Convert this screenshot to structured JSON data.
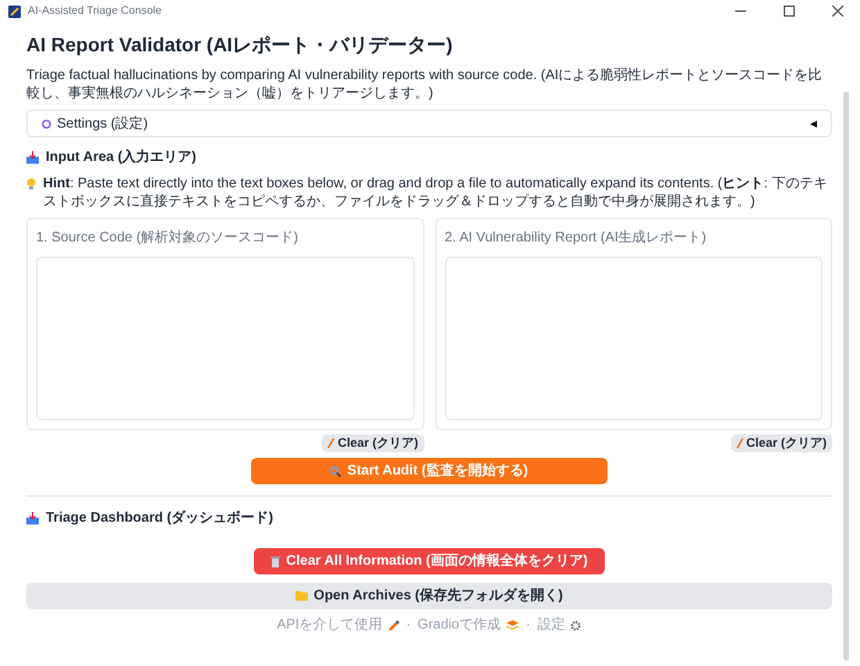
{
  "window": {
    "title": "AI-Assisted Triage Console"
  },
  "heading": "AI Report Validator (AIレポート・バリデーター)",
  "description": "Triage factual hallucinations by comparing AI vulnerability reports with source code. (AIによる脆弱性レポートとソースコードを比較し、事実無根のハルシネーション（嘘）をトリアージします。)",
  "settings": {
    "label": "Settings (設定)",
    "expanded": false
  },
  "input_area": {
    "title": "Input Area (入力エリア)",
    "hint": "**Hint**: Paste text directly into the text boxes below, or drag and drop a file to automatically expand its contents. (**ヒント**: 下のテキストボックスに直接テキストをコピペするか、ファイルをドラッグ＆ドロップすると自動で中身が展開されます。)",
    "fields": [
      {
        "label": "1. Source Code (解析対象のソースコード)",
        "clear": "Clear (クリア)"
      },
      {
        "label": "2. AI Vulnerability Report (AI生成レポート)",
        "clear": "Clear (クリア)"
      }
    ]
  },
  "start_button": "Start Audit (監査を開始する)",
  "dashboard": {
    "title": "Triage Dashboard (ダッシュボード)"
  },
  "clear_all_button": "Clear All Information (画面の情報全体をクリア)",
  "archives_button": "Open Archives (保存先フォルダを開く)",
  "footer": {
    "separator": "·",
    "links": [
      {
        "kind": "api",
        "label": "APIを介して使用"
      },
      {
        "kind": "gradio",
        "label": "Gradioで作成"
      },
      {
        "kind": "settings",
        "label": "設定"
      }
    ]
  }
}
